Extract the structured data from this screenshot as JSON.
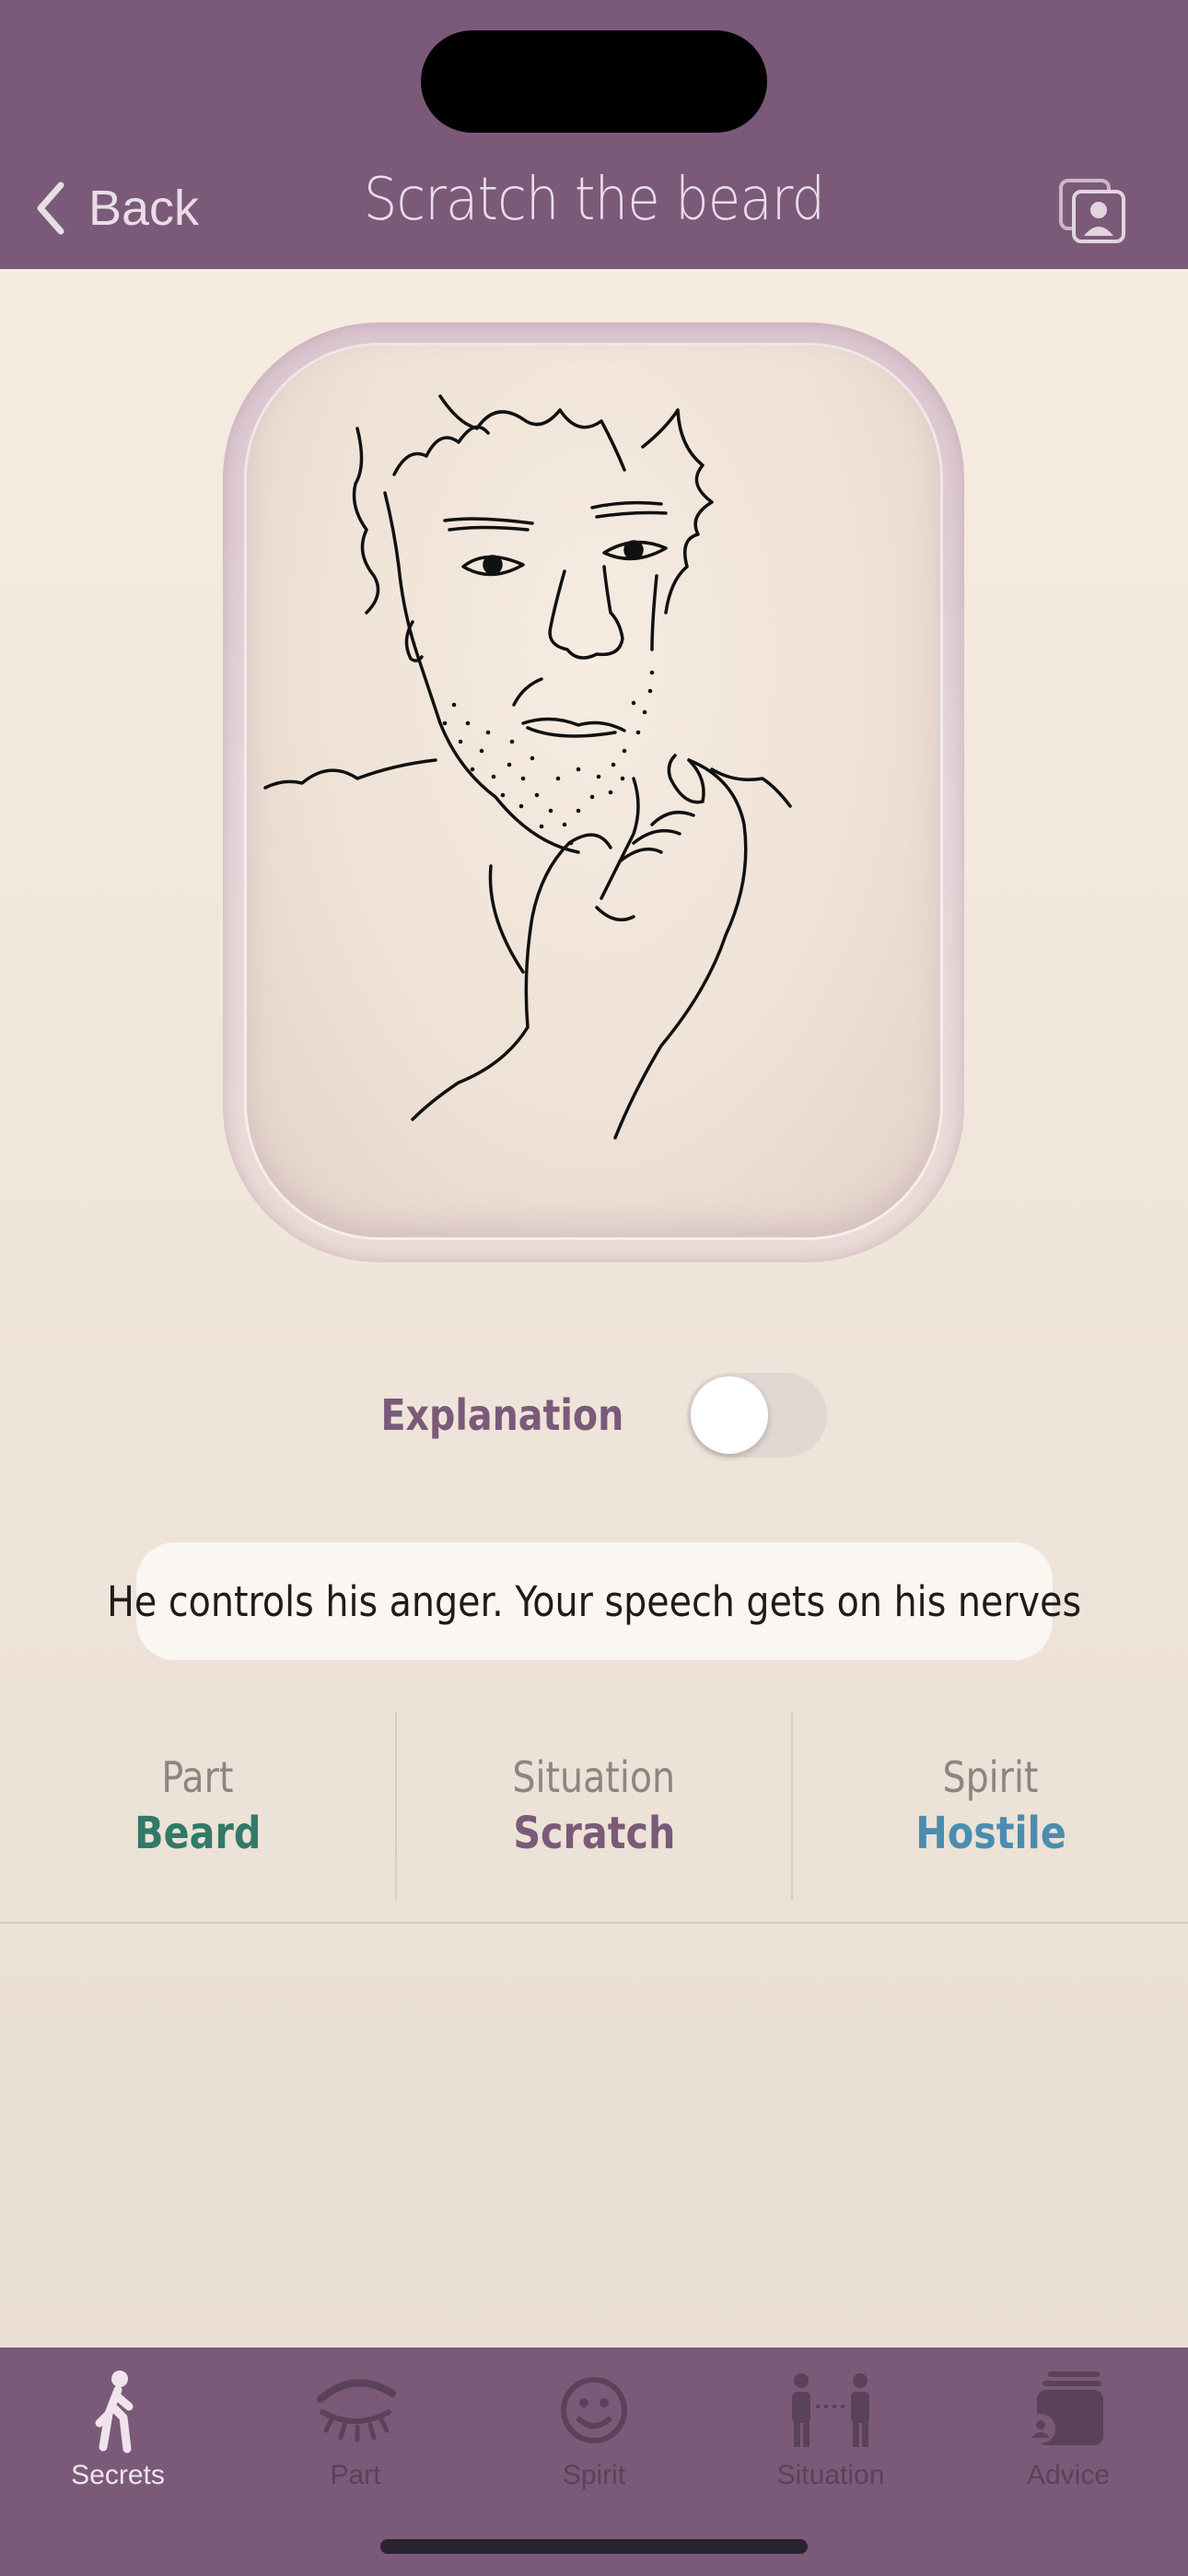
{
  "nav": {
    "back_label": "Back",
    "title": "Scratch the beard",
    "back_icon": "chevron-left-icon",
    "right_icon": "contact-card-icon"
  },
  "illustration": {
    "subject": "line-drawing-man-scratching-beard"
  },
  "explanation_toggle": {
    "label": "Explanation",
    "on": false
  },
  "explanation_text": "He controls his anger. Your speech gets on his nerves",
  "attributes": [
    {
      "key": "Part",
      "value": "Beard",
      "color": "#2f7a68"
    },
    {
      "key": "Situation",
      "value": "Scratch",
      "color": "#7a5a78"
    },
    {
      "key": "Spirit",
      "value": "Hostile",
      "color": "#4a8db0"
    }
  ],
  "tabs": [
    {
      "label": "Secrets",
      "icon": "walking-person-icon",
      "active": true
    },
    {
      "label": "Part",
      "icon": "eye-icon",
      "active": false
    },
    {
      "label": "Spirit",
      "icon": "smiley-icon",
      "active": false
    },
    {
      "label": "Situation",
      "icon": "two-people-icon",
      "active": false
    },
    {
      "label": "Advice",
      "icon": "stacked-cards-icon",
      "active": false
    }
  ],
  "colors": {
    "header_bg": "#7a5a78",
    "accent": "#7a5a78",
    "tab_inactive": "#5a4258",
    "tab_active": "#efe4ec"
  }
}
